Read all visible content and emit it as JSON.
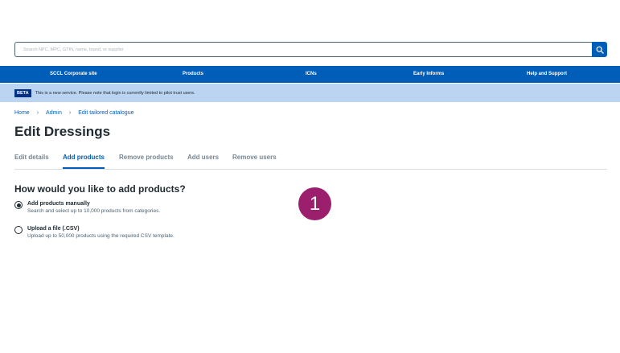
{
  "search": {
    "placeholder": "Search NPC, MPC, GTIN, name, brand, or supplier"
  },
  "nav": {
    "items": [
      {
        "label": "SCCL Corporate site"
      },
      {
        "label": "Products"
      },
      {
        "label": "ICNs"
      },
      {
        "label": "Early Informs"
      },
      {
        "label": "Help and Support"
      }
    ]
  },
  "beta": {
    "tag": "BETA",
    "message": "This is a new service. Please note that login is currently limited to pilot trust users."
  },
  "breadcrumb": {
    "items": [
      "Home",
      "Admin",
      "Edit tailored catalogue"
    ],
    "separator": "›"
  },
  "page": {
    "title": "Edit Dressings"
  },
  "tabs": [
    {
      "label": "Edit details",
      "active": false
    },
    {
      "label": "Add products",
      "active": true
    },
    {
      "label": "Remove products",
      "active": false
    },
    {
      "label": "Add users",
      "active": false
    },
    {
      "label": "Remove users",
      "active": false
    }
  ],
  "form": {
    "question": "How would you like to add products?",
    "options": [
      {
        "label": "Add products manually",
        "hint": "Search and select up to 10,000 products from categories.",
        "selected": true
      },
      {
        "label": "Upload a file (.CSV)",
        "hint": "Upload up to 50,000 products using the required CSV template.",
        "selected": false
      }
    ]
  },
  "step_badge": {
    "number": "1"
  },
  "colors": {
    "primary": "#005eb8",
    "beta_bg": "#bbd4f1",
    "beta_tag": "#003087",
    "badge": "#9c1f6e",
    "text": "#212b32"
  },
  "icons": {
    "search_button": "search-icon"
  }
}
